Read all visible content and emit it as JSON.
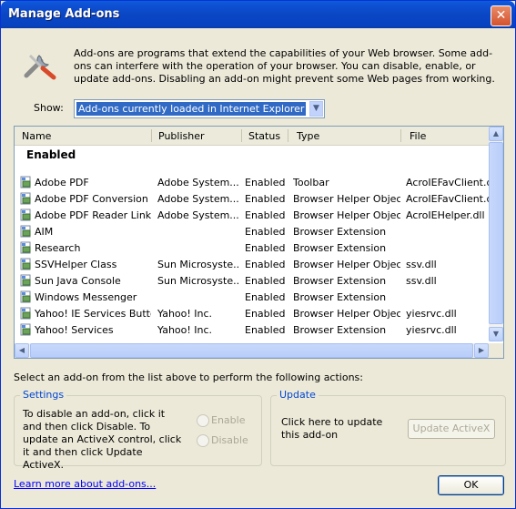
{
  "window": {
    "title": "Manage Add-ons",
    "close_glyph": "✕"
  },
  "intro": "Add-ons are programs that extend the capabilities of your Web browser. Some add-ons can interfere with the operation of your browser. You can disable, enable, or update add-ons. Disabling an add-on might prevent some Web pages from working.",
  "show": {
    "label": "Show:",
    "selected": "Add-ons currently loaded in Internet Explorer"
  },
  "list": {
    "columns": [
      "Name",
      "Publisher",
      "Status",
      "Type",
      "File"
    ],
    "group": "Enabled",
    "rows": [
      [
        "Adobe PDF",
        "Adobe System...",
        "Enabled",
        "Toolbar",
        "AcroIEFavClient.dll"
      ],
      [
        "Adobe PDF Conversion ...",
        "Adobe System...",
        "Enabled",
        "Browser Helper Object",
        "AcroIEFavClient.dll"
      ],
      [
        "Adobe PDF Reader Link...",
        "Adobe System...",
        "Enabled",
        "Browser Helper Object",
        "AcroIEHelper.dll"
      ],
      [
        "AIM",
        "",
        "Enabled",
        "Browser Extension",
        ""
      ],
      [
        "Research",
        "",
        "Enabled",
        "Browser Extension",
        ""
      ],
      [
        "SSVHelper Class",
        "Sun Microsyste...",
        "Enabled",
        "Browser Helper Object",
        "ssv.dll"
      ],
      [
        "Sun Java Console",
        "Sun Microsyste...",
        "Enabled",
        "Browser Extension",
        "ssv.dll"
      ],
      [
        "Windows Messenger",
        "",
        "Enabled",
        "Browser Extension",
        ""
      ],
      [
        "Yahoo! IE Services Button",
        "Yahoo! Inc.",
        "Enabled",
        "Browser Helper Object",
        "yiesrvc.dll"
      ],
      [
        "Yahoo! Services",
        "Yahoo! Inc.",
        "Enabled",
        "Browser Extension",
        "yiesrvc.dll"
      ]
    ]
  },
  "actions_text": "Select an add-on from the list above to perform the following actions:",
  "settings": {
    "title": "Settings",
    "text": "To disable an add-on, click it and then click Disable. To update an ActiveX control, click it and then click Update ActiveX.",
    "enable_label": "Enable",
    "disable_label": "Disable"
  },
  "update": {
    "title": "Update",
    "text": "Click here to update this add-on",
    "button": "Update ActiveX"
  },
  "learn_link": "Learn more about add-ons...",
  "ok_label": "OK",
  "icons": {
    "tools": "tools-icon",
    "addon": "addon-icon"
  }
}
